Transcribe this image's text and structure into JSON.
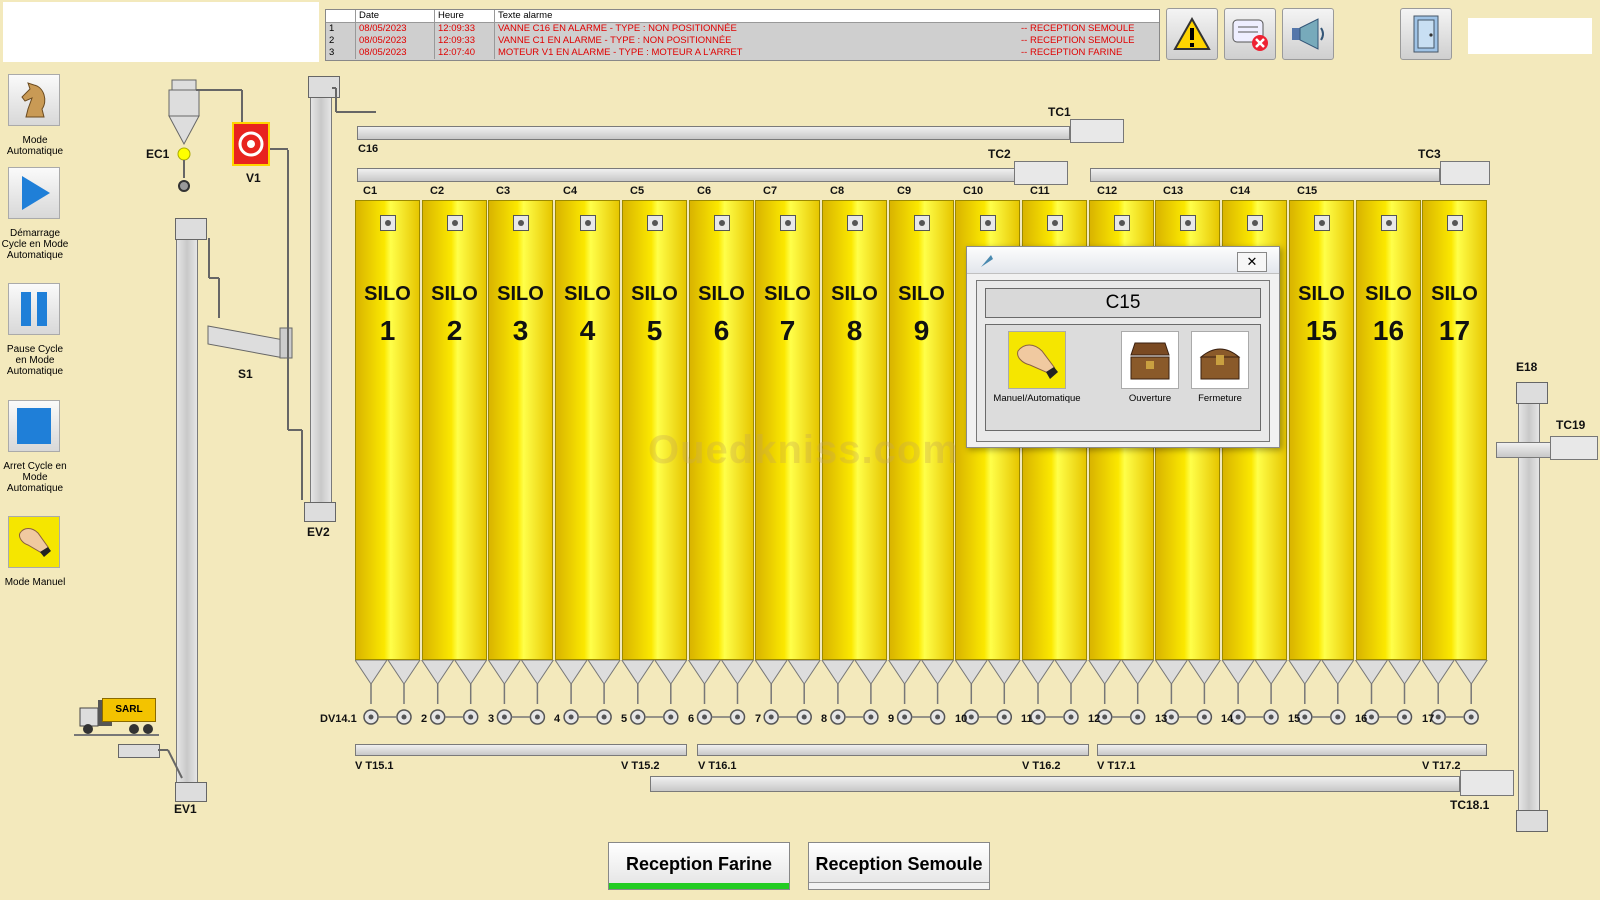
{
  "alarm_table": {
    "headers": [
      "",
      "Date",
      "Heure",
      "Texte alarme"
    ],
    "rows": [
      {
        "idx": "1",
        "date": "08/05/2023",
        "time": "12:09:33",
        "text": "VANNE C16 EN ALARME - TYPE : NON POSITIONNÉE",
        "zone": "-- RECEPTION SEMOULE"
      },
      {
        "idx": "2",
        "date": "08/05/2023",
        "time": "12:09:33",
        "text": "VANNE C1 EN ALARME - TYPE : NON POSITIONNÉE",
        "zone": "-- RECEPTION SEMOULE"
      },
      {
        "idx": "3",
        "date": "08/05/2023",
        "time": "12:07:40",
        "text": "MOTEUR V1 EN ALARME - TYPE : MOTEUR A L'ARRET",
        "zone": "-- RECEPTION FARINE"
      }
    ]
  },
  "toolbar": {
    "icons": [
      "warning-icon",
      "alarm-clear-icon",
      "horn-icon",
      "exit-door-icon"
    ]
  },
  "left_menu": [
    {
      "label": "Mode Automatique",
      "icon": "chess-knight-icon"
    },
    {
      "label": "Démarrage Cycle en Mode Automatique",
      "icon": "play-icon"
    },
    {
      "label": "Pause Cycle en Mode Automatique",
      "icon": "pause-icon"
    },
    {
      "label": "Arret Cycle en Mode Automatique",
      "icon": "stop-icon"
    },
    {
      "label": "Mode Manuel",
      "icon": "hand-icon"
    }
  ],
  "equipment": {
    "ec1": "EC1",
    "v1": "V1",
    "s1": "S1",
    "ev1": "EV1",
    "ev2": "EV2",
    "tc1": "TC1",
    "tc2": "TC2",
    "tc3": "TC3",
    "c16": "C16",
    "e18": "E18",
    "tc19": "TC19",
    "tc18": "TC18.1",
    "dv": "DV14.1",
    "truck": "SARL",
    "vt": [
      "V T15.1",
      "V T15.2",
      "V T16.1",
      "V T16.2",
      "V T17.1",
      "V T17.2"
    ]
  },
  "valves": [
    "C1",
    "C2",
    "C3",
    "C4",
    "C5",
    "C6",
    "C7",
    "C8",
    "C9",
    "C10",
    "C11",
    "C12",
    "C13",
    "C14",
    "C15"
  ],
  "silo_word": "SILO",
  "silos": [
    "1",
    "2",
    "3",
    "4",
    "5",
    "6",
    "7",
    "8",
    "9",
    "",
    "",
    "",
    "",
    "",
    "15",
    "16",
    "17"
  ],
  "dv_numbers": [
    "2",
    "3",
    "4",
    "5",
    "6",
    "7",
    "8",
    "9",
    "10",
    "11",
    "12",
    "13",
    "14",
    "15",
    "16",
    "17"
  ],
  "popup": {
    "title": "C15",
    "buttons": [
      {
        "label": "Manuel/Automatique",
        "icon": "hand-icon"
      },
      {
        "label": "Ouverture",
        "icon": "open-chest-icon"
      },
      {
        "label": "Fermeture",
        "icon": "closed-chest-icon"
      }
    ]
  },
  "bottom_buttons": [
    {
      "label": "Reception Farine",
      "color": "#22cc22"
    },
    {
      "label": "Reception Semoule",
      "color": "#f2f2f2"
    }
  ],
  "watermark": "Ouedkniss.com",
  "colors": {
    "silo": "#f7e300",
    "alarm_text": "#e00000",
    "motor": "#e8231f"
  }
}
